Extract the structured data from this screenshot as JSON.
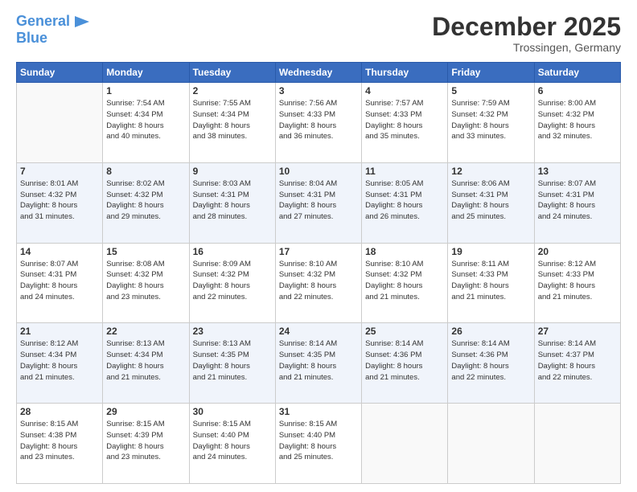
{
  "header": {
    "logo_line1": "General",
    "logo_line2": "Blue",
    "month": "December 2025",
    "location": "Trossingen, Germany"
  },
  "days_of_week": [
    "Sunday",
    "Monday",
    "Tuesday",
    "Wednesday",
    "Thursday",
    "Friday",
    "Saturday"
  ],
  "weeks": [
    [
      {
        "day": "",
        "info": ""
      },
      {
        "day": "1",
        "info": "Sunrise: 7:54 AM\nSunset: 4:34 PM\nDaylight: 8 hours\nand 40 minutes."
      },
      {
        "day": "2",
        "info": "Sunrise: 7:55 AM\nSunset: 4:34 PM\nDaylight: 8 hours\nand 38 minutes."
      },
      {
        "day": "3",
        "info": "Sunrise: 7:56 AM\nSunset: 4:33 PM\nDaylight: 8 hours\nand 36 minutes."
      },
      {
        "day": "4",
        "info": "Sunrise: 7:57 AM\nSunset: 4:33 PM\nDaylight: 8 hours\nand 35 minutes."
      },
      {
        "day": "5",
        "info": "Sunrise: 7:59 AM\nSunset: 4:32 PM\nDaylight: 8 hours\nand 33 minutes."
      },
      {
        "day": "6",
        "info": "Sunrise: 8:00 AM\nSunset: 4:32 PM\nDaylight: 8 hours\nand 32 minutes."
      }
    ],
    [
      {
        "day": "7",
        "info": "Sunrise: 8:01 AM\nSunset: 4:32 PM\nDaylight: 8 hours\nand 31 minutes."
      },
      {
        "day": "8",
        "info": "Sunrise: 8:02 AM\nSunset: 4:32 PM\nDaylight: 8 hours\nand 29 minutes."
      },
      {
        "day": "9",
        "info": "Sunrise: 8:03 AM\nSunset: 4:31 PM\nDaylight: 8 hours\nand 28 minutes."
      },
      {
        "day": "10",
        "info": "Sunrise: 8:04 AM\nSunset: 4:31 PM\nDaylight: 8 hours\nand 27 minutes."
      },
      {
        "day": "11",
        "info": "Sunrise: 8:05 AM\nSunset: 4:31 PM\nDaylight: 8 hours\nand 26 minutes."
      },
      {
        "day": "12",
        "info": "Sunrise: 8:06 AM\nSunset: 4:31 PM\nDaylight: 8 hours\nand 25 minutes."
      },
      {
        "day": "13",
        "info": "Sunrise: 8:07 AM\nSunset: 4:31 PM\nDaylight: 8 hours\nand 24 minutes."
      }
    ],
    [
      {
        "day": "14",
        "info": "Sunrise: 8:07 AM\nSunset: 4:31 PM\nDaylight: 8 hours\nand 24 minutes."
      },
      {
        "day": "15",
        "info": "Sunrise: 8:08 AM\nSunset: 4:32 PM\nDaylight: 8 hours\nand 23 minutes."
      },
      {
        "day": "16",
        "info": "Sunrise: 8:09 AM\nSunset: 4:32 PM\nDaylight: 8 hours\nand 22 minutes."
      },
      {
        "day": "17",
        "info": "Sunrise: 8:10 AM\nSunset: 4:32 PM\nDaylight: 8 hours\nand 22 minutes."
      },
      {
        "day": "18",
        "info": "Sunrise: 8:10 AM\nSunset: 4:32 PM\nDaylight: 8 hours\nand 21 minutes."
      },
      {
        "day": "19",
        "info": "Sunrise: 8:11 AM\nSunset: 4:33 PM\nDaylight: 8 hours\nand 21 minutes."
      },
      {
        "day": "20",
        "info": "Sunrise: 8:12 AM\nSunset: 4:33 PM\nDaylight: 8 hours\nand 21 minutes."
      }
    ],
    [
      {
        "day": "21",
        "info": "Sunrise: 8:12 AM\nSunset: 4:34 PM\nDaylight: 8 hours\nand 21 minutes."
      },
      {
        "day": "22",
        "info": "Sunrise: 8:13 AM\nSunset: 4:34 PM\nDaylight: 8 hours\nand 21 minutes."
      },
      {
        "day": "23",
        "info": "Sunrise: 8:13 AM\nSunset: 4:35 PM\nDaylight: 8 hours\nand 21 minutes."
      },
      {
        "day": "24",
        "info": "Sunrise: 8:14 AM\nSunset: 4:35 PM\nDaylight: 8 hours\nand 21 minutes."
      },
      {
        "day": "25",
        "info": "Sunrise: 8:14 AM\nSunset: 4:36 PM\nDaylight: 8 hours\nand 21 minutes."
      },
      {
        "day": "26",
        "info": "Sunrise: 8:14 AM\nSunset: 4:36 PM\nDaylight: 8 hours\nand 22 minutes."
      },
      {
        "day": "27",
        "info": "Sunrise: 8:14 AM\nSunset: 4:37 PM\nDaylight: 8 hours\nand 22 minutes."
      }
    ],
    [
      {
        "day": "28",
        "info": "Sunrise: 8:15 AM\nSunset: 4:38 PM\nDaylight: 8 hours\nand 23 minutes."
      },
      {
        "day": "29",
        "info": "Sunrise: 8:15 AM\nSunset: 4:39 PM\nDaylight: 8 hours\nand 23 minutes."
      },
      {
        "day": "30",
        "info": "Sunrise: 8:15 AM\nSunset: 4:40 PM\nDaylight: 8 hours\nand 24 minutes."
      },
      {
        "day": "31",
        "info": "Sunrise: 8:15 AM\nSunset: 4:40 PM\nDaylight: 8 hours\nand 25 minutes."
      },
      {
        "day": "",
        "info": ""
      },
      {
        "day": "",
        "info": ""
      },
      {
        "day": "",
        "info": ""
      }
    ]
  ]
}
